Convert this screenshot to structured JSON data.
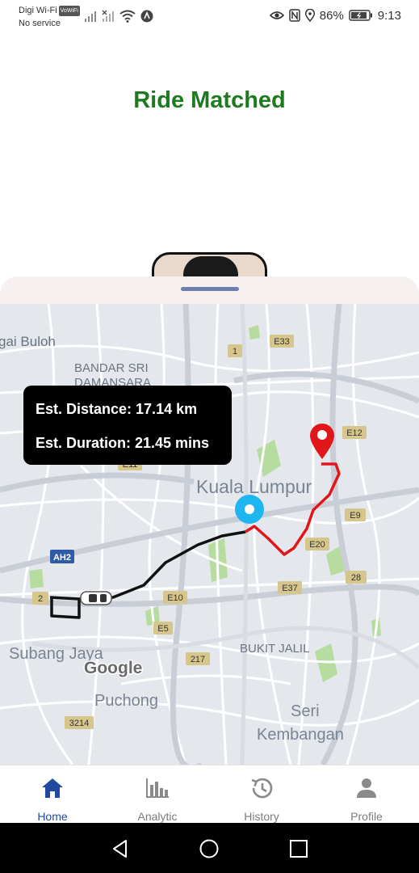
{
  "status_bar": {
    "carrier": "Digi Wi-Fi",
    "vowifi_badge": "VoWiFi",
    "service": "No service",
    "battery": "86%",
    "time": "9:13"
  },
  "title": "Ride Matched",
  "trip_info": {
    "distance": "Est. Distance: 17.14 km",
    "duration": "Est. Duration: 21.45 mins"
  },
  "map": {
    "labels": {
      "sungai_buloh": "gai Buloh",
      "bandar_sri": "BANDAR SRI",
      "damansara": "DAMANSARA",
      "kuala_lumpur": "Kuala Lumpur",
      "subang_jaya": "Subang Jaya",
      "puchong": "Puchong",
      "bukit_jalil": "BUKIT JALIL",
      "seri": "Seri",
      "kembangan": "Kembangan",
      "google": "Google"
    },
    "shields": {
      "e33": "E33",
      "r1": "1",
      "e12": "E12",
      "e11": "E11",
      "e9": "E9",
      "e20": "E20",
      "r28": "28",
      "ah2": "AH2",
      "r2": "2",
      "e10": "E10",
      "e37": "E37",
      "e5": "E5",
      "r217": "217",
      "r3214": "3214"
    },
    "colors": {
      "driver_route": "#111111",
      "passenger_route": "#e0161b",
      "pickup_marker": "#1fb6f0",
      "destination_marker": "#e0161b"
    }
  },
  "bottom_nav": {
    "items": [
      {
        "label": "Home",
        "icon": "home-icon",
        "active": true
      },
      {
        "label": "Analytic",
        "icon": "bar-chart-icon",
        "active": false
      },
      {
        "label": "History",
        "icon": "history-icon",
        "active": false
      },
      {
        "label": "Profile",
        "icon": "person-icon",
        "active": false
      }
    ]
  },
  "colors": {
    "title": "#1e7a1e",
    "nav_active": "#1f4aa0",
    "nav_inactive": "#7b7b7b"
  }
}
